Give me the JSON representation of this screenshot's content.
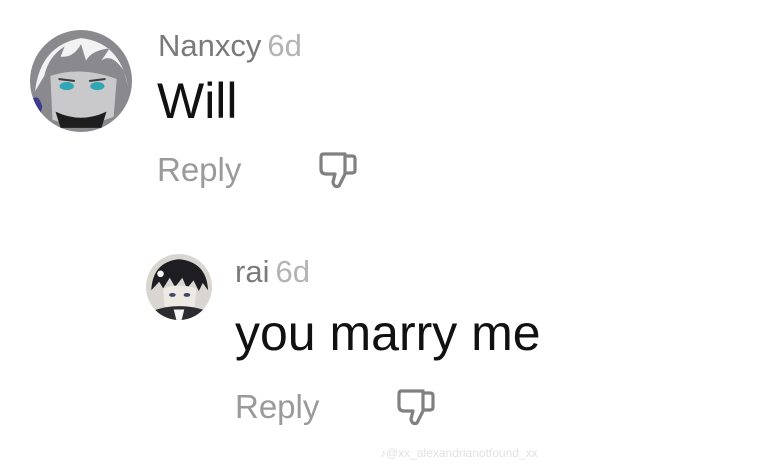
{
  "comments": [
    {
      "username": "Nanxcy",
      "time": "6d",
      "text": "Will",
      "reply_label": "Reply",
      "avatar_icon": "anime-avatar-white-hair",
      "dislike_icon": "thumbs-down-icon"
    },
    {
      "username": "rai",
      "time": "6d",
      "text": "you marry me",
      "reply_label": "Reply",
      "avatar_icon": "anime-avatar-dark-hair",
      "dislike_icon": "thumbs-down-icon"
    }
  ],
  "watermark": "♪@xx_alexandrianotfound_xx",
  "colors": {
    "username": "#7a7a7a",
    "timestamp": "#b3b3b3",
    "text": "#111111",
    "action": "#9a9a9a"
  }
}
